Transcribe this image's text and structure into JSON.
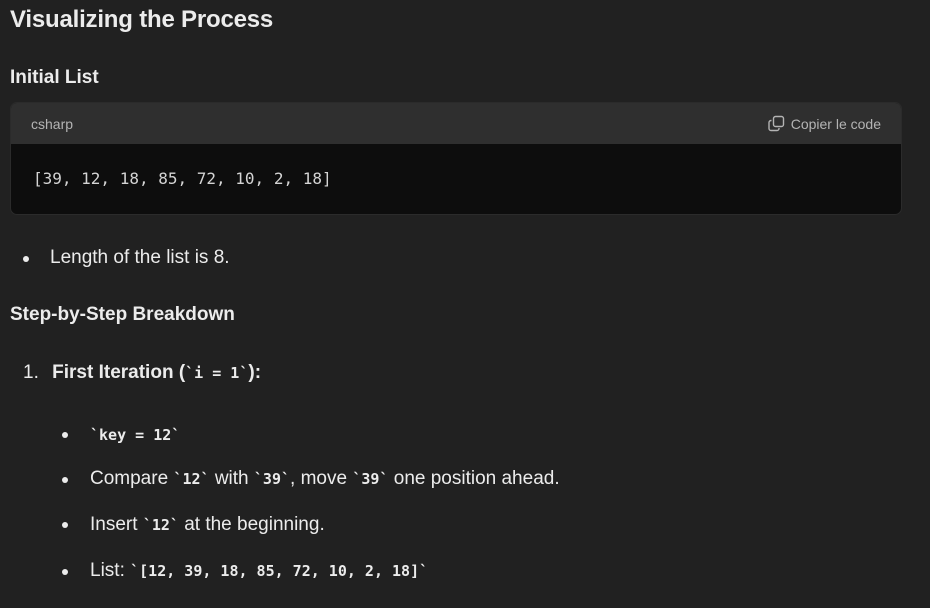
{
  "heading": "Visualizing the Process",
  "initial_list": {
    "title": "Initial List",
    "code_lang": "csharp",
    "copy_label": "Copier le code",
    "code_text": "[39, 12, 18, 85, 72, 10, 2, 18]"
  },
  "length_bullet": "Length of the list is 8.",
  "breakdown_title": "Step-by-Step Breakdown",
  "step1": {
    "number": "1.",
    "title_prefix": "First Iteration (",
    "title_code": "`i = 1`",
    "title_suffix": "):",
    "bullets": {
      "b1_code": "`key = 12`",
      "b2_t1": "Compare ",
      "b2_c1": "`12`",
      "b2_t2": " with ",
      "b2_c2": "`39`",
      "b2_t3": ", move ",
      "b2_c3": "`39`",
      "b2_t4": " one position ahead.",
      "b3_t1": "Insert ",
      "b3_c1": "`12`",
      "b3_t2": " at the beginning.",
      "b4_t1": "List: ",
      "b4_c1": "`[12, 39, 18, 85, 72, 10, 2, 18]`"
    }
  }
}
